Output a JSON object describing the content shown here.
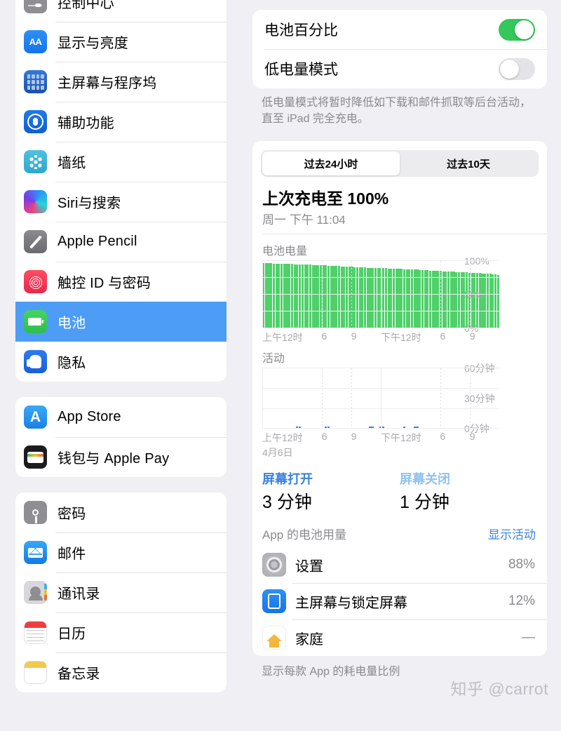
{
  "sidebar": {
    "groups": [
      {
        "items": [
          {
            "label": "控制中心",
            "icon": "control-center-icon",
            "selected": false
          },
          {
            "label": "显示与亮度",
            "icon": "display-brightness-icon",
            "selected": false
          },
          {
            "label": "主屏幕与程序坞",
            "icon": "home-screen-dock-icon",
            "selected": false
          },
          {
            "label": "辅助功能",
            "icon": "accessibility-icon",
            "selected": false
          },
          {
            "label": "墙纸",
            "icon": "wallpaper-icon",
            "selected": false
          },
          {
            "label": "Siri与搜索",
            "icon": "siri-search-icon",
            "selected": false
          },
          {
            "label": "Apple Pencil",
            "icon": "apple-pencil-icon",
            "selected": false
          },
          {
            "label": "触控 ID 与密码",
            "icon": "touch-id-passcode-icon",
            "selected": false
          },
          {
            "label": "电池",
            "icon": "battery-icon",
            "selected": true
          },
          {
            "label": "隐私",
            "icon": "privacy-icon",
            "selected": false
          }
        ]
      },
      {
        "items": [
          {
            "label": "App Store",
            "icon": "app-store-icon",
            "selected": false
          },
          {
            "label": "钱包与 Apple Pay",
            "icon": "wallet-apple-pay-icon",
            "selected": false
          }
        ]
      },
      {
        "items": [
          {
            "label": "密码",
            "icon": "passwords-icon",
            "selected": false
          },
          {
            "label": "邮件",
            "icon": "mail-icon",
            "selected": false
          },
          {
            "label": "通讯录",
            "icon": "contacts-icon",
            "selected": false
          },
          {
            "label": "日历",
            "icon": "calendar-icon",
            "selected": false
          },
          {
            "label": "备忘录",
            "icon": "notes-icon",
            "selected": false
          }
        ]
      }
    ]
  },
  "main": {
    "settings": [
      {
        "label": "电池百分比",
        "state": "on"
      },
      {
        "label": "低电量模式",
        "state": "off"
      }
    ],
    "footnote": "低电量模式将暂时降低如下载和邮件抓取等后台活动，直至 iPad 完全充电。",
    "segmented": {
      "options": [
        "过去24小时",
        "过去10天"
      ],
      "selected_index": 0
    },
    "last_charge_title": "上次充电至 100%",
    "last_charge_sub": "周一 下午 11:04",
    "stats": {
      "screen_on_label": "屏幕打开",
      "screen_on_value": "3 分钟",
      "screen_off_label": "屏幕关闭",
      "screen_off_value": "1 分钟"
    },
    "usage_header": {
      "title": "App 的电池用量",
      "action": "显示活动"
    },
    "apps": [
      {
        "name": "设置",
        "pct": "88%",
        "icon": "settings-app-icon"
      },
      {
        "name": "主屏幕与锁定屏幕",
        "pct": "12%",
        "icon": "home-lock-screen-icon"
      },
      {
        "name": "家庭",
        "pct": "—",
        "icon": "home-app-icon"
      }
    ],
    "bottom_note": "显示每款 App 的耗电量比例",
    "watermark": "知乎 @carrot"
  },
  "colors": {
    "accent_blue": "#3B82E0",
    "selected_row": "#4D9DF6",
    "toggle_on": "#34C759",
    "battery_bar": "#4FD06A",
    "activity_bar": "#3B82E0",
    "page_bg": "#EFEFF4"
  },
  "chart_data": [
    {
      "type": "bar",
      "title": "电池电量",
      "xlabel": "",
      "ylabel": "",
      "ylim": [
        0,
        100
      ],
      "yticks": [
        0,
        50,
        100
      ],
      "ytick_labels": [
        "0%",
        "50%",
        "100%"
      ],
      "xtick_labels": [
        "上午12时",
        "6",
        "9",
        "下午12时",
        "6",
        "9"
      ],
      "xtick_positions": [
        0,
        25,
        37.5,
        50,
        75,
        87.5
      ],
      "grid": true,
      "bar_color": "#4FD06A",
      "categories": [
        "00:00",
        "00:15",
        "00:30",
        "00:45",
        "01:00",
        "01:15",
        "01:30",
        "01:45",
        "02:00",
        "02:15",
        "02:30",
        "02:45",
        "03:00",
        "03:15",
        "03:30",
        "03:45",
        "04:00",
        "04:15",
        "04:30",
        "04:45",
        "05:00",
        "05:15",
        "05:30",
        "05:45",
        "06:00",
        "06:15",
        "06:30",
        "06:45",
        "07:00",
        "07:15",
        "07:30",
        "07:45",
        "08:00",
        "08:15",
        "08:30",
        "08:45",
        "09:00",
        "09:15",
        "09:30",
        "09:45",
        "10:00",
        "10:15",
        "10:30",
        "10:45",
        "11:00",
        "11:15",
        "11:30",
        "11:45",
        "12:00",
        "12:15",
        "12:30",
        "12:45",
        "13:00",
        "13:15",
        "13:30",
        "13:45",
        "14:00",
        "14:15",
        "14:30",
        "14:45",
        "15:00",
        "15:15",
        "15:30",
        "15:45",
        "16:00",
        "16:15",
        "16:30",
        "16:45",
        "17:00",
        "17:15",
        "17:30",
        "17:45",
        "18:00",
        "18:15",
        "18:30",
        "18:45",
        "19:00",
        "19:15",
        "19:30",
        "19:45",
        "20:00",
        "20:15",
        "20:30",
        "20:45",
        "21:00",
        "21:15",
        "21:30",
        "21:45",
        "22:00",
        "22:15",
        "22:30"
      ],
      "values": [
        97,
        97,
        96.8,
        96.8,
        96.6,
        96.5,
        96.5,
        96.3,
        96.2,
        96,
        96,
        95.8,
        95.6,
        95.5,
        95.3,
        95.2,
        95,
        94.9,
        94.7,
        94.6,
        94.4,
        94.2,
        94,
        93.9,
        93.7,
        93.5,
        93.3,
        93,
        92.8,
        92.6,
        92.5,
        92.3,
        92,
        91.8,
        91.6,
        91.4,
        91.2,
        91,
        90.8,
        90.6,
        90.4,
        90.3,
        90.1,
        90,
        90,
        89.8,
        89.7,
        89.5,
        89.3,
        89.1,
        89,
        88.8,
        88.6,
        88.5,
        88.3,
        88.1,
        88,
        87.8,
        87.6,
        87.4,
        87.2,
        87,
        86.8,
        86.5,
        86.3,
        86,
        85.8,
        85.6,
        85.4,
        85.2,
        85,
        84.8,
        84.6,
        84.4,
        84.2,
        84,
        83.8,
        83.6,
        83.4,
        83.2,
        83,
        82.8,
        82.6,
        82.3,
        82,
        81.8,
        81.5,
        81.2,
        81,
        80.6,
        79.8
      ]
    },
    {
      "type": "bar",
      "title": "活动",
      "xlabel": "4月6日",
      "ylabel": "",
      "ylim": [
        0,
        60
      ],
      "yticks": [
        0,
        30,
        60
      ],
      "ytick_labels": [
        "0分钟",
        "30分钟",
        "60分钟"
      ],
      "xtick_labels": [
        "上午12时",
        "6",
        "9",
        "下午12时",
        "6",
        "9"
      ],
      "xtick_positions": [
        0,
        25,
        37.5,
        50,
        75,
        87.5
      ],
      "grid": true,
      "bar_color": "#3B82E0",
      "unit": "分钟",
      "active_slots": [
        {
          "index": 13,
          "value": 1.5
        },
        {
          "index": 14,
          "value": 1.5
        },
        {
          "index": 24,
          "value": 1.5
        },
        {
          "index": 25,
          "value": 1.5
        },
        {
          "index": 41,
          "value": 1.5
        },
        {
          "index": 42,
          "value": 1.5
        },
        {
          "index": 45,
          "value": 1.5
        },
        {
          "index": 46,
          "value": 1.5
        },
        {
          "index": 54,
          "value": 0.7
        },
        {
          "index": 58,
          "value": 1.5
        },
        {
          "index": 59,
          "value": 1.5
        }
      ],
      "slot_count": 91
    }
  ]
}
